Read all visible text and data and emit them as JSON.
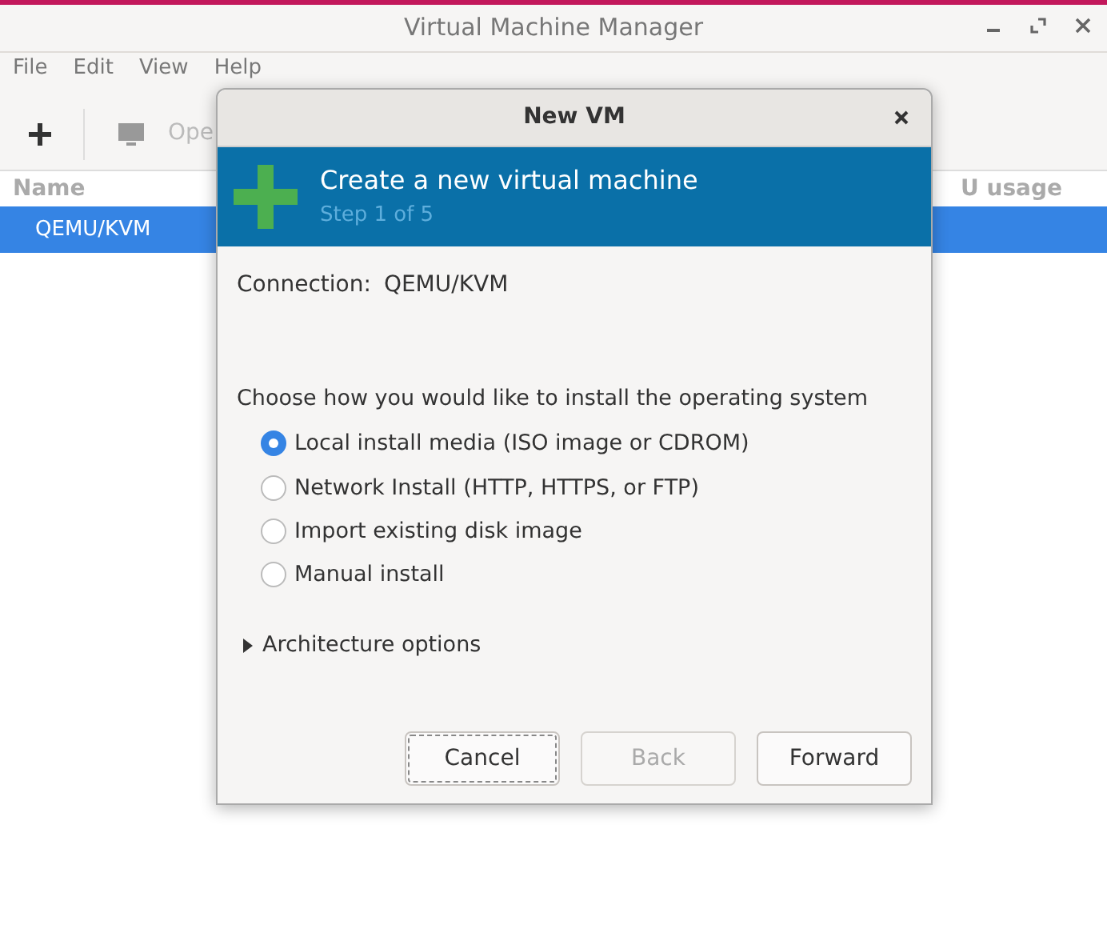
{
  "window": {
    "title": "Virtual Machine Manager"
  },
  "menu": [
    "File",
    "Edit",
    "View",
    "Help"
  ],
  "toolbar": {
    "open_label": "Ope"
  },
  "table": {
    "columns": [
      "Name",
      "U usage"
    ],
    "rows": [
      {
        "name": "QEMU/KVM",
        "selected": true
      }
    ]
  },
  "dialog": {
    "title": "New VM",
    "heading": "Create a new virtual machine",
    "step": "Step 1 of 5",
    "connection_label": "Connection:",
    "connection_value": "QEMU/KVM",
    "prompt": "Choose how you would like to install the operating system",
    "options": [
      {
        "label": "Local install media (ISO image or CDROM)",
        "selected": true
      },
      {
        "label": "Network Install (HTTP, HTTPS, or FTP)",
        "selected": false
      },
      {
        "label": "Import existing disk image",
        "selected": false
      },
      {
        "label": "Manual install",
        "selected": false
      }
    ],
    "expander": {
      "label": "Architecture options",
      "expanded": false
    },
    "buttons": [
      {
        "label": "Cancel",
        "disabled": false,
        "focused": true
      },
      {
        "label": "Back",
        "disabled": true,
        "focused": false
      },
      {
        "label": "Forward",
        "disabled": false,
        "focused": false
      }
    ]
  }
}
